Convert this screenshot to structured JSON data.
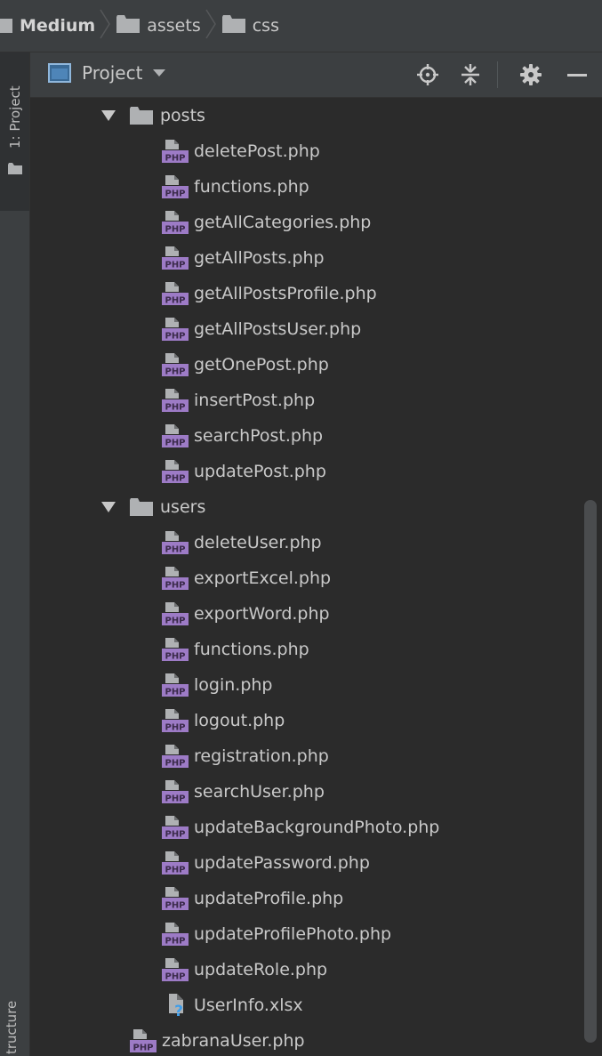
{
  "breadcrumb": {
    "items": [
      {
        "label": "Medium",
        "bold": true
      },
      {
        "label": "assets",
        "bold": false
      },
      {
        "label": "css",
        "bold": false
      }
    ]
  },
  "side_strip": {
    "project_tab": "1: Project",
    "structure_tab": "tructure"
  },
  "tool_window": {
    "title": "Project",
    "tools": [
      "locate-icon",
      "collapse-all-icon",
      "gear-icon",
      "hide-icon"
    ]
  },
  "tree": {
    "items": [
      {
        "type": "folder",
        "name": "posts",
        "level": 1,
        "expanded": true
      },
      {
        "type": "php",
        "name": "deletePost.php",
        "level": 2
      },
      {
        "type": "php",
        "name": "functions.php",
        "level": 2
      },
      {
        "type": "php",
        "name": "getAllCategories.php",
        "level": 2
      },
      {
        "type": "php",
        "name": "getAllPosts.php",
        "level": 2
      },
      {
        "type": "php",
        "name": "getAllPostsProfile.php",
        "level": 2
      },
      {
        "type": "php",
        "name": "getAllPostsUser.php",
        "level": 2
      },
      {
        "type": "php",
        "name": "getOnePost.php",
        "level": 2
      },
      {
        "type": "php",
        "name": "insertPost.php",
        "level": 2
      },
      {
        "type": "php",
        "name": "searchPost.php",
        "level": 2
      },
      {
        "type": "php",
        "name": "updatePost.php",
        "level": 2
      },
      {
        "type": "folder",
        "name": "users",
        "level": 1,
        "expanded": true
      },
      {
        "type": "php",
        "name": "deleteUser.php",
        "level": 2
      },
      {
        "type": "php",
        "name": "exportExcel.php",
        "level": 2
      },
      {
        "type": "php",
        "name": "exportWord.php",
        "level": 2
      },
      {
        "type": "php",
        "name": "functions.php",
        "level": 2
      },
      {
        "type": "php",
        "name": "login.php",
        "level": 2
      },
      {
        "type": "php",
        "name": "logout.php",
        "level": 2
      },
      {
        "type": "php",
        "name": "registration.php",
        "level": 2
      },
      {
        "type": "php",
        "name": "searchUser.php",
        "level": 2
      },
      {
        "type": "php",
        "name": "updateBackgroundPhoto.php",
        "level": 2
      },
      {
        "type": "php",
        "name": "updatePassword.php",
        "level": 2
      },
      {
        "type": "php",
        "name": "updateProfile.php",
        "level": 2
      },
      {
        "type": "php",
        "name": "updateProfilePhoto.php",
        "level": 2
      },
      {
        "type": "php",
        "name": "updateRole.php",
        "level": 2
      },
      {
        "type": "unknown",
        "name": "UserInfo.xlsx",
        "level": 2
      },
      {
        "type": "php",
        "name": "zabranaUser.php",
        "level": 1
      }
    ]
  },
  "colors": {
    "background": "#2B2B2B",
    "panel": "#3C3F41",
    "folder": "#AFB1B3",
    "php_icon": "#9D7BC6",
    "unknown_badge": "#3D9DEB",
    "text": "#C9C9C9"
  }
}
